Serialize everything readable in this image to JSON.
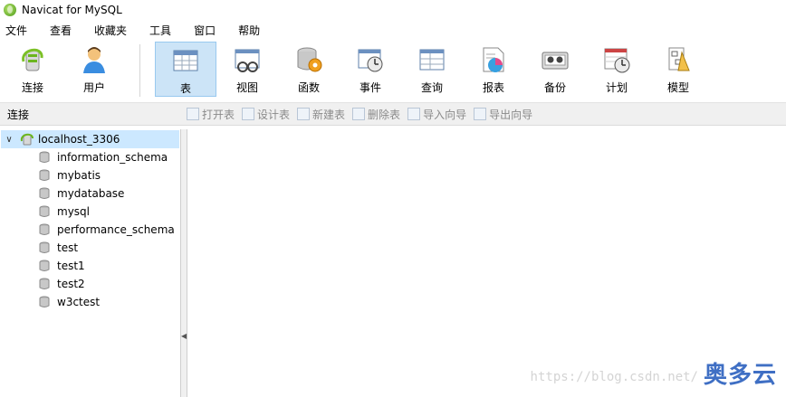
{
  "window": {
    "title": "Navicat for MySQL"
  },
  "menu": [
    "文件",
    "查看",
    "收藏夹",
    "工具",
    "窗口",
    "帮助"
  ],
  "toolbar": {
    "left": [
      {
        "label": "连接",
        "icon": "connection-icon"
      },
      {
        "label": "用户",
        "icon": "user-icon"
      }
    ],
    "right": [
      {
        "label": "表",
        "icon": "table-icon",
        "active": true
      },
      {
        "label": "视图",
        "icon": "view-icon"
      },
      {
        "label": "函数",
        "icon": "function-icon"
      },
      {
        "label": "事件",
        "icon": "event-icon"
      },
      {
        "label": "查询",
        "icon": "query-icon"
      },
      {
        "label": "报表",
        "icon": "report-icon"
      },
      {
        "label": "备份",
        "icon": "backup-icon"
      },
      {
        "label": "计划",
        "icon": "schedule-icon"
      },
      {
        "label": "模型",
        "icon": "model-icon"
      }
    ]
  },
  "subbar": {
    "connection_label": "连接",
    "actions": [
      "打开表",
      "设计表",
      "新建表",
      "删除表",
      "导入向导",
      "导出向导"
    ]
  },
  "tree": {
    "connection": "localhost_3306",
    "databases": [
      "information_schema",
      "mybatis",
      "mydatabase",
      "mysql",
      "performance_schema",
      "test",
      "test1",
      "test2",
      "w3ctest"
    ]
  },
  "watermark": {
    "url": "https://blog.csdn.net/",
    "brand": "奥多云"
  }
}
